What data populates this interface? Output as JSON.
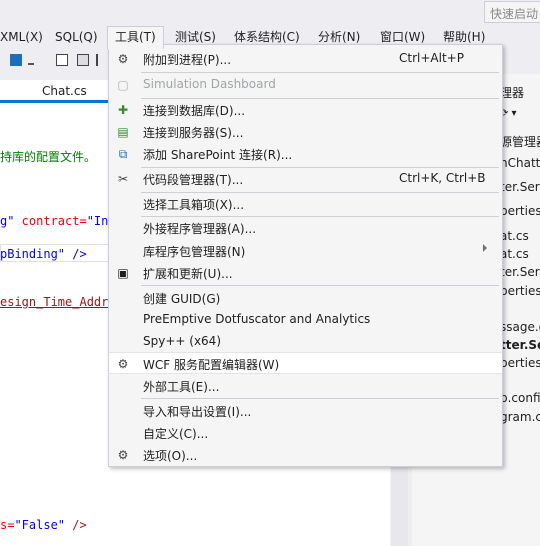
{
  "quick_launch": {
    "placeholder": "快速启动"
  },
  "menubar": {
    "items": [
      "XML(X)",
      "SQL(Q)",
      "工具(T)",
      "测试(S)",
      "体系结构(C)",
      "分析(N)",
      "窗口(W)",
      "帮助(H)"
    ],
    "active": "工具(T)"
  },
  "editor": {
    "tab_title": "Chat.cs",
    "lines": {
      "l1": "持库的配置文件。",
      "l2_a": "g\"",
      "l2_b": " contract=",
      "l2_c": "\"In",
      "l3": "pBinding\" />",
      "l4": "esign_Time_Addr",
      "l5_a": "s=",
      "l5_b": "\"False\"",
      "l5_c": " />"
    }
  },
  "solution_explorer": {
    "header": "理器",
    "items": [
      {
        "text": "源管理器",
        "bold": false
      },
      {
        "text": "nChatte",
        "bold": false
      },
      {
        "text": "ter.Serv",
        "bold": false
      },
      {
        "text": "perties",
        "bold": false
      },
      {
        "text": "at.cs",
        "bold": false
      },
      {
        "text": "at.cs",
        "bold": false
      },
      {
        "text": "ter.Serv",
        "bold": false
      },
      {
        "text": "perties",
        "bold": false
      },
      {
        "text": "ssage.c",
        "bold": false
      },
      {
        "text": "tter.Serv",
        "bold": true
      },
      {
        "text": "perties",
        "bold": false
      },
      {
        "text": "p.config",
        "bold": false
      },
      {
        "text": "gram.cs",
        "bold": false
      }
    ]
  },
  "tools_menu": {
    "items": [
      {
        "label": "附加到进程(P)...",
        "shortcut": "Ctrl+Alt+P",
        "icon": "attach-process-icon",
        "disabled": false
      },
      {
        "label": "Simulation Dashboard",
        "shortcut": "",
        "icon": "simulation-icon",
        "disabled": true
      },
      {
        "label": "连接到数据库(D)...",
        "shortcut": "",
        "icon": "connect-database-icon",
        "disabled": false
      },
      {
        "label": "连接到服务器(S)...",
        "shortcut": "",
        "icon": "connect-server-icon",
        "disabled": false
      },
      {
        "label": "添加 SharePoint 连接(R)...",
        "shortcut": "",
        "icon": "sharepoint-icon",
        "disabled": false
      },
      {
        "label": "代码段管理器(T)...",
        "shortcut": "Ctrl+K, Ctrl+B",
        "icon": "snippet-icon",
        "disabled": false
      },
      {
        "label": "选择工具箱项(X)...",
        "shortcut": "",
        "icon": "",
        "disabled": false
      },
      {
        "label": "外接程序管理器(A)...",
        "shortcut": "",
        "icon": "",
        "disabled": false
      },
      {
        "label": "库程序包管理器(N)",
        "shortcut": "",
        "icon": "",
        "disabled": false,
        "submenu": true
      },
      {
        "label": "扩展和更新(U)...",
        "shortcut": "",
        "icon": "extensions-icon",
        "disabled": false
      },
      {
        "label": "创建 GUID(G)",
        "shortcut": "",
        "icon": "",
        "disabled": false
      },
      {
        "label": "PreEmptive Dotfuscator and Analytics",
        "shortcut": "",
        "icon": "",
        "disabled": false
      },
      {
        "label": "Spy++ (x64)",
        "shortcut": "",
        "icon": "",
        "disabled": false
      },
      {
        "label": "WCF 服务配置编辑器(W)",
        "shortcut": "",
        "icon": "wcf-config-icon",
        "disabled": false,
        "hover": true
      },
      {
        "label": "外部工具(E)...",
        "shortcut": "",
        "icon": "",
        "disabled": false
      },
      {
        "label": "导入和导出设置(I)...",
        "shortcut": "",
        "icon": "",
        "disabled": false
      },
      {
        "label": "自定义(C)...",
        "shortcut": "",
        "icon": "",
        "disabled": false
      },
      {
        "label": "选项(O)...",
        "shortcut": "",
        "icon": "gear-icon",
        "disabled": false
      }
    ]
  },
  "colors": {
    "accent": "#007acc",
    "menu_bg": "#f5f5f5",
    "hover_bg": "#ffffff",
    "selection": "#cce8ff"
  }
}
